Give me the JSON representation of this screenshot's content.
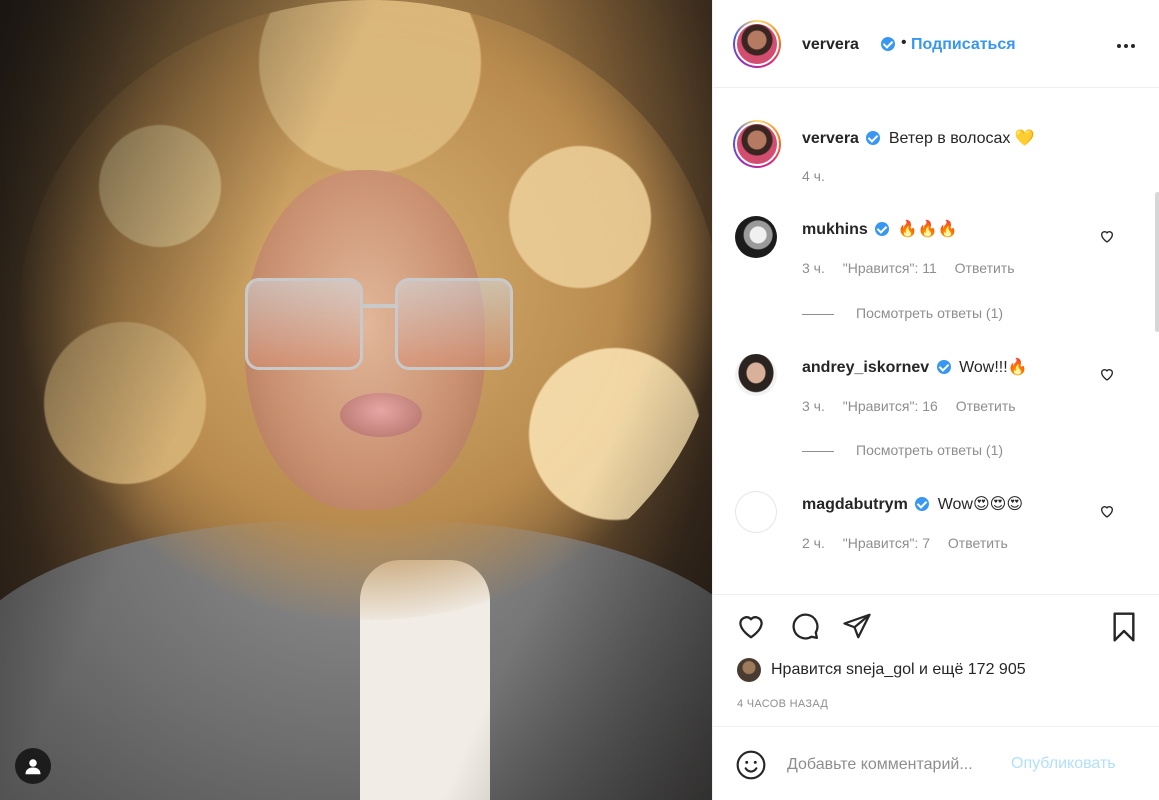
{
  "post": {
    "author": "ververa",
    "follow_label": "Подписаться",
    "dot": "•",
    "caption": "Ветер в волосах 💛",
    "caption_time": "4 ч."
  },
  "comments": [
    {
      "user": "mukhins",
      "text": "🔥🔥🔥",
      "time": "3 ч.",
      "likes": "\"Нравится\": 11",
      "reply": "Ответить",
      "view_replies": "Посмотреть ответы (1)"
    },
    {
      "user": "andrey_iskornev",
      "text": "Wow!!!🔥",
      "time": "3 ч.",
      "likes": "\"Нравится\": 16",
      "reply": "Ответить",
      "view_replies": "Посмотреть ответы (1)"
    },
    {
      "user": "magdabutrym",
      "text": "Wow😍😍😍",
      "time": "2 ч.",
      "likes": "\"Нравится\": 7",
      "reply": "Ответить"
    }
  ],
  "likes_line": "Нравится sneja_gol и ещё 172 905",
  "posted_ago": "4 ЧАСОВ НАЗАД",
  "comment_box": {
    "placeholder": "Добавьте комментарий...",
    "post_label": "Опубликовать"
  },
  "icons": [
    "tag-user-icon",
    "more-options-icon",
    "verified-badge-icon",
    "heart-icon",
    "comment-icon",
    "share-icon",
    "bookmark-icon",
    "emoji-icon"
  ],
  "colors": {
    "link": "#3897f0",
    "post_disabled": "#b2dffc",
    "muted": "#8e8e8e",
    "text": "#262626"
  }
}
